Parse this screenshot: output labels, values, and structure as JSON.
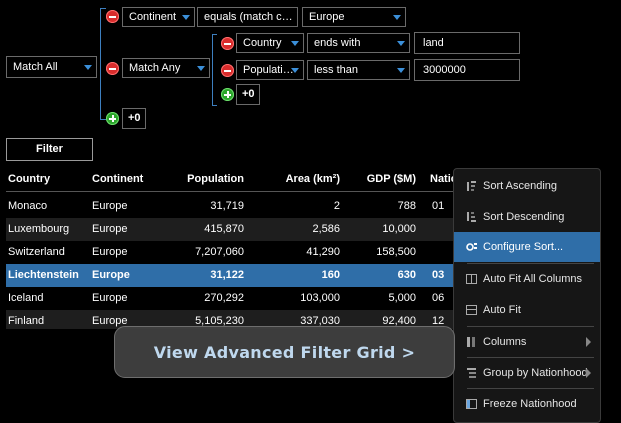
{
  "filter_builder": {
    "root_operator": "Match All",
    "row_continent": {
      "field": "Continent",
      "operator": "equals (match c…",
      "value": "Europe"
    },
    "group": {
      "operator": "Match Any",
      "row_country": {
        "field": "Country",
        "operator": "ends with",
        "value": "land"
      },
      "row_population": {
        "field": "Populati…",
        "operator": "less than",
        "value": "3000000"
      },
      "add_count": "+0"
    },
    "root_add_count": "+0",
    "filter_button": "Filter"
  },
  "grid": {
    "columns": [
      "Country",
      "Continent",
      "Population",
      "Area (km²)",
      "GDP ($M)",
      "Natio"
    ],
    "rows": [
      {
        "country": "Monaco",
        "continent": "Europe",
        "population": "31,719",
        "area": "2",
        "gdp": "788",
        "nation": "01"
      },
      {
        "country": "Luxembourg",
        "continent": "Europe",
        "population": "415,870",
        "area": "2,586",
        "gdp": "10,000",
        "nation": ""
      },
      {
        "country": "Switzerland",
        "continent": "Europe",
        "population": "7,207,060",
        "area": "41,290",
        "gdp": "158,500",
        "nation": ""
      },
      {
        "country": "Liechtenstein",
        "continent": "Europe",
        "population": "31,122",
        "area": "160",
        "gdp": "630",
        "nation": "03"
      },
      {
        "country": "Iceland",
        "continent": "Europe",
        "population": "270,292",
        "area": "103,000",
        "gdp": "5,000",
        "nation": "06"
      },
      {
        "country": "Finland",
        "continent": "Europe",
        "population": "5,105,230",
        "area": "337,030",
        "gdp": "92,400",
        "nation": "12"
      }
    ],
    "selected_row_index": 3
  },
  "context_menu": {
    "items": [
      {
        "label": "Sort Ascending",
        "icon": "sort-ascending-icon"
      },
      {
        "label": "Sort Descending",
        "icon": "sort-descending-icon"
      },
      {
        "label": "Configure Sort...",
        "icon": "configure-sort-icon",
        "active": true
      },
      {
        "label": "Auto Fit All Columns",
        "icon": "auto-fit-all-icon"
      },
      {
        "label": "Auto Fit",
        "icon": "auto-fit-icon"
      },
      {
        "label": "Columns",
        "icon": "columns-icon",
        "submenu": true
      },
      {
        "label": "Group by Nationhood",
        "icon": "group-icon",
        "submenu": true
      },
      {
        "label": "Freeze Nationhood",
        "icon": "freeze-icon"
      }
    ]
  },
  "overlay": {
    "label": "View Advanced Filter Grid >"
  },
  "colors": {
    "accent": "#2f6ea8",
    "remove": "#d92c2c",
    "add": "#2ca52c",
    "bracket": "#3d7fbf"
  }
}
